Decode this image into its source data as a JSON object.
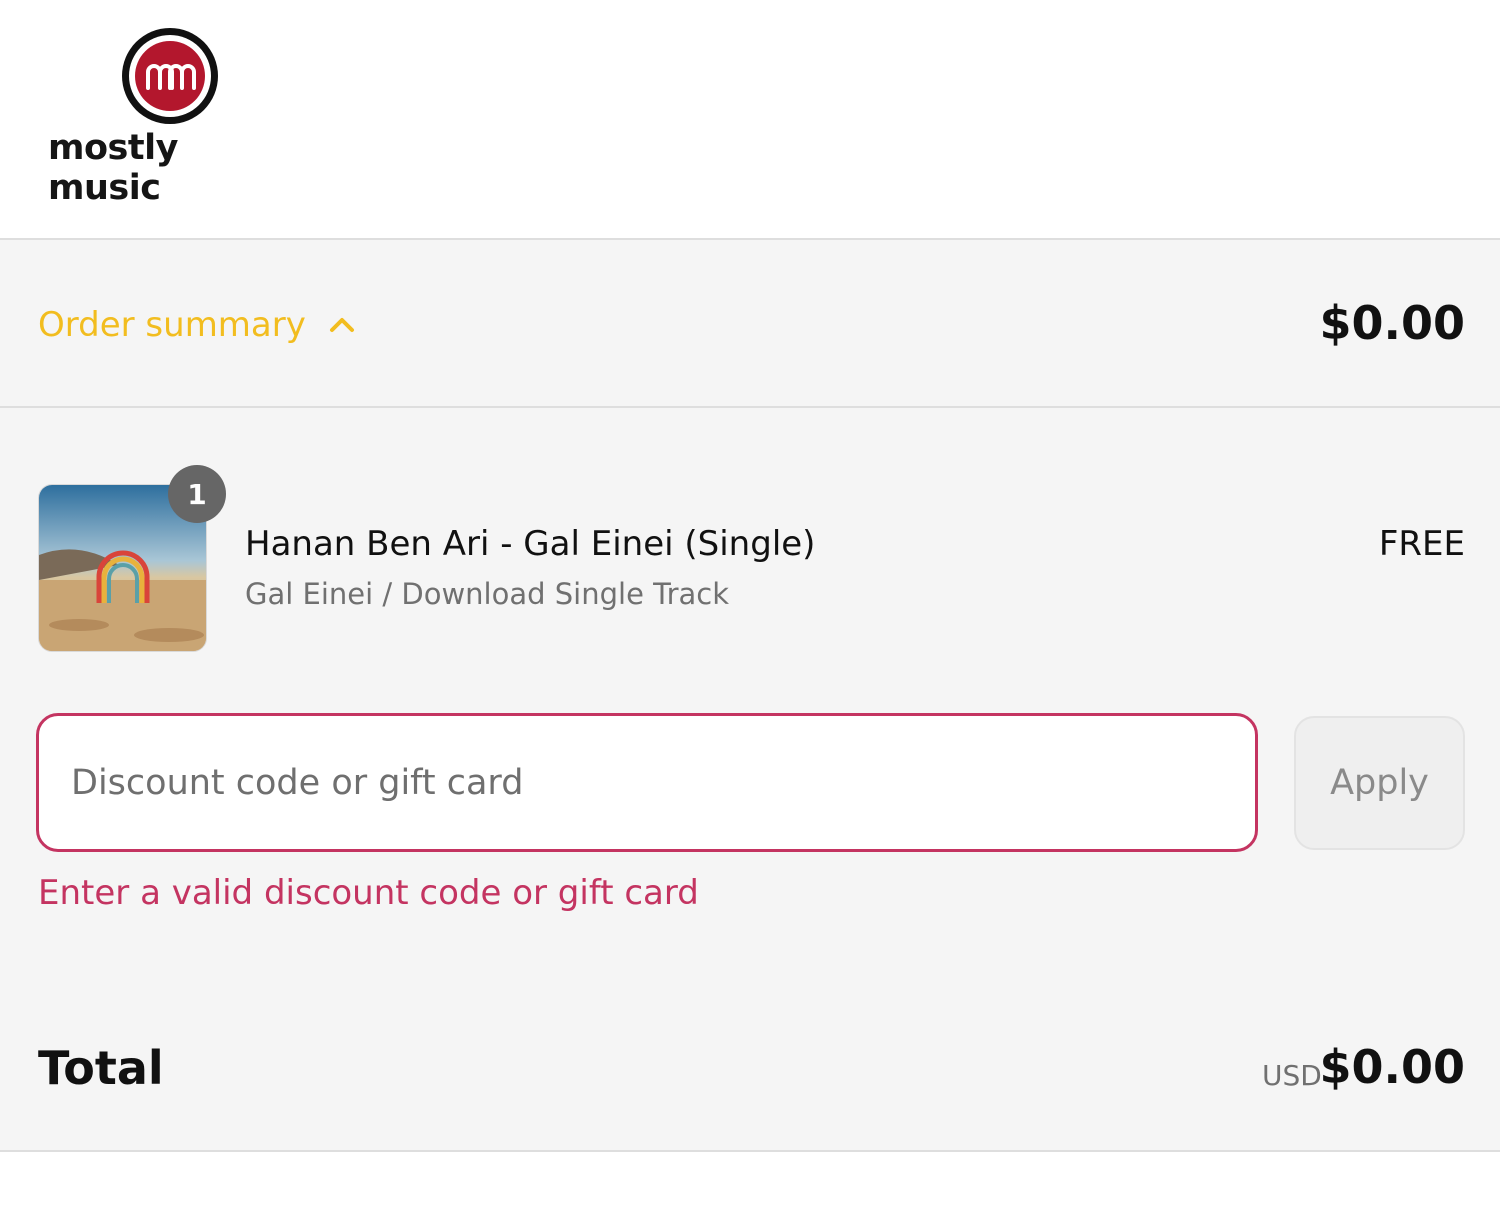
{
  "brand": {
    "name": "mostly music",
    "logo_mark_text": "mm",
    "colors": {
      "logo_red": "#b3172d",
      "accent_yellow": "#f2bd1f",
      "error": "#c43461"
    }
  },
  "order_summary": {
    "toggle_label": "Order summary",
    "toggle_icon": "chevron-up-icon",
    "price": "$0.00"
  },
  "line_item": {
    "quantity": "1",
    "title": "Hanan Ben Ari - Gal Einei (Single)",
    "variant": "Gal Einei / Download Single Track",
    "price": "FREE"
  },
  "discount": {
    "placeholder": "Discount code or gift card",
    "value": "",
    "apply_label": "Apply",
    "error": "Enter a valid discount code or gift card"
  },
  "total": {
    "label": "Total",
    "currency": "USD",
    "amount": "$0.00"
  }
}
